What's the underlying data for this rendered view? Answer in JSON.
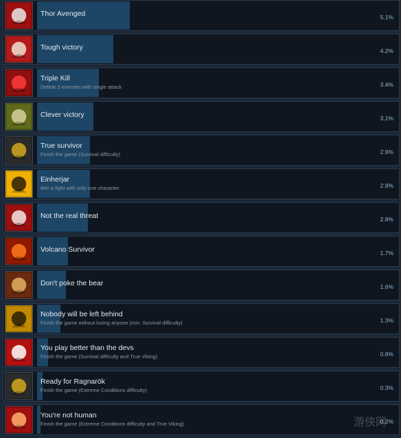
{
  "achievements": [
    {
      "name": "Thor Avenged",
      "description": "",
      "percent": "5.1%",
      "fill": 0.051,
      "icon": "thor-avenged-icon",
      "colors": [
        "#a01010",
        "#e8e8e8"
      ]
    },
    {
      "name": "Tough victory",
      "description": "",
      "percent": "4.2%",
      "fill": 0.042,
      "icon": "tough-victory-icon",
      "colors": [
        "#b31b1b",
        "#f0e0d0"
      ]
    },
    {
      "name": "Triple Kill",
      "description": "Defeat 3 enemies with single attack",
      "percent": "3.4%",
      "fill": 0.034,
      "icon": "triple-kill-icon",
      "colors": [
        "#8e0f0f",
        "#ff3b3b"
      ]
    },
    {
      "name": "Clever victory",
      "description": "",
      "percent": "3.1%",
      "fill": 0.031,
      "icon": "clever-victory-icon",
      "colors": [
        "#5f6b1a",
        "#d8d0a0"
      ]
    },
    {
      "name": "True survivor",
      "description": "Finish the game (Survival difficulty)",
      "percent": "2.9%",
      "fill": 0.029,
      "icon": "true-survivor-icon",
      "colors": [
        "#2b2b2b",
        "#d5a81b"
      ]
    },
    {
      "name": "Einherjar",
      "description": "Win a fight with only one character",
      "percent": "2.9%",
      "fill": 0.029,
      "icon": "einherjar-icon",
      "colors": [
        "#f0b000",
        "#2a1f05"
      ]
    },
    {
      "name": "Not the real threat",
      "description": "",
      "percent": "2.8%",
      "fill": 0.028,
      "icon": "not-real-threat-icon",
      "colors": [
        "#9d0f0f",
        "#f2e5e5"
      ]
    },
    {
      "name": "Volcano Survivor",
      "description": "",
      "percent": "1.7%",
      "fill": 0.017,
      "icon": "volcano-survivor-icon",
      "colors": [
        "#8f1a00",
        "#ff7a1a"
      ]
    },
    {
      "name": "Don't poke the bear",
      "description": "",
      "percent": "1.6%",
      "fill": 0.016,
      "icon": "dont-poke-bear-icon",
      "colors": [
        "#6a2a10",
        "#e2b060"
      ]
    },
    {
      "name": "Nobody will be left behind",
      "description": "Finish the game without losing anyone (min. Survival difficulty)",
      "percent": "1.3%",
      "fill": 0.013,
      "icon": "nobody-left-behind-icon",
      "colors": [
        "#c28a00",
        "#2a1f05"
      ]
    },
    {
      "name": "You play better than the devs",
      "description": "Finish the game (Survival difficulty and True Viking)",
      "percent": "0.6%",
      "fill": 0.006,
      "icon": "better-than-devs-icon",
      "colors": [
        "#b31111",
        "#ffffff"
      ]
    },
    {
      "name": "Ready for Ragnarök",
      "description": "Finish the game (Extreme Conditions difficulty)",
      "percent": "0.3%",
      "fill": 0.003,
      "icon": "ready-for-ragnarok-icon",
      "colors": [
        "#2b2b2b",
        "#d5a81b"
      ]
    },
    {
      "name": "You're not human",
      "description": "Finish the game (Extreme Conditions difficulty and True Viking)",
      "percent": "0.2%",
      "fill": 0.002,
      "icon": "youre-not-human-icon",
      "colors": [
        "#a01010",
        "#ffb070"
      ]
    }
  ],
  "watermark": {
    "text": "游侠网"
  },
  "theme": {
    "row_bg": "#10161f",
    "bar_fill": "#1d4566",
    "text_primary": "#e6ebf0",
    "text_secondary": "#8f98a0",
    "accent": "#8fb8d8"
  }
}
